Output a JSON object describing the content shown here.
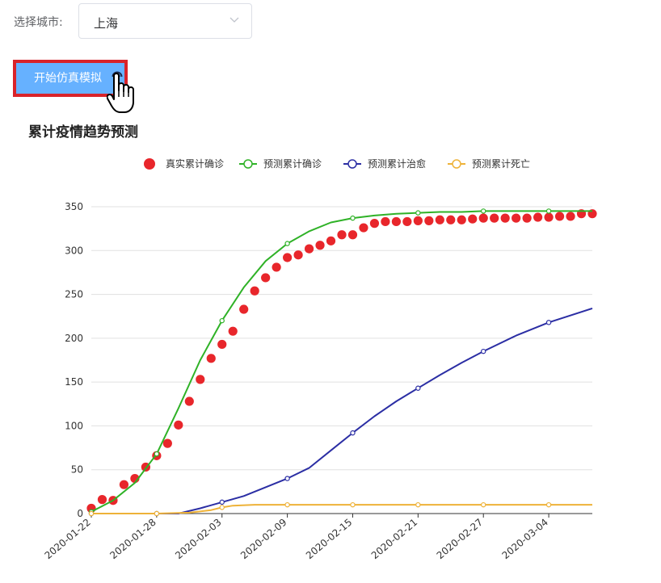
{
  "form": {
    "label": "选择城市:",
    "city_select": {
      "value": "上海"
    }
  },
  "start_button": {
    "label": "开始仿真模拟"
  },
  "colors": {
    "real": "#e8262b",
    "pred_confirmed": "#2fb227",
    "pred_recovered": "#2b2ea4",
    "pred_death": "#eeb238",
    "button": "#66b1ff",
    "button_border": "#d9232a"
  },
  "chart_data": {
    "type": "line",
    "title": "累计疫情趋势预测",
    "xlabel": "",
    "ylabel": "",
    "ylim": [
      0,
      350
    ],
    "yticks": [
      0,
      50,
      100,
      150,
      200,
      250,
      300,
      350
    ],
    "legend_position": "top-center",
    "grid": "horizontal",
    "x_start": "2020-01-22",
    "x_end": "2020-03-08",
    "xticks": [
      "2020-01-22",
      "2020-01-28",
      "2020-02-03",
      "2020-02-09",
      "2020-02-15",
      "2020-02-21",
      "2020-02-27",
      "2020-03-04"
    ],
    "series": [
      {
        "name": "真实累计确诊",
        "kind": "scatter",
        "x": [
          "2020-01-22",
          "2020-01-23",
          "2020-01-24",
          "2020-01-25",
          "2020-01-26",
          "2020-01-27",
          "2020-01-28",
          "2020-01-29",
          "2020-01-30",
          "2020-01-31",
          "2020-02-01",
          "2020-02-02",
          "2020-02-03",
          "2020-02-04",
          "2020-02-05",
          "2020-02-06",
          "2020-02-07",
          "2020-02-08",
          "2020-02-09",
          "2020-02-10",
          "2020-02-11",
          "2020-02-12",
          "2020-02-13",
          "2020-02-14",
          "2020-02-15",
          "2020-02-16",
          "2020-02-17",
          "2020-02-18",
          "2020-02-19",
          "2020-02-20",
          "2020-02-21",
          "2020-02-22",
          "2020-02-23",
          "2020-02-24",
          "2020-02-25",
          "2020-02-26",
          "2020-02-27",
          "2020-02-28",
          "2020-02-29",
          "2020-03-01",
          "2020-03-02",
          "2020-03-03",
          "2020-03-04",
          "2020-03-05",
          "2020-03-06",
          "2020-03-07",
          "2020-03-08"
        ],
        "values": [
          6,
          16,
          15,
          33,
          40,
          53,
          66,
          80,
          101,
          128,
          153,
          177,
          193,
          208,
          233,
          254,
          269,
          281,
          292,
          295,
          302,
          306,
          311,
          318,
          318,
          326,
          331,
          333,
          333,
          333,
          334,
          334,
          335,
          335,
          335,
          336,
          337,
          337,
          337,
          337,
          337,
          338,
          338,
          339,
          339,
          342,
          342
        ]
      },
      {
        "name": "预测累计确诊",
        "kind": "line",
        "x": [
          "2020-01-22",
          "2020-01-24",
          "2020-01-26",
          "2020-01-28",
          "2020-01-30",
          "2020-02-01",
          "2020-02-03",
          "2020-02-05",
          "2020-02-07",
          "2020-02-09",
          "2020-02-11",
          "2020-02-13",
          "2020-02-15",
          "2020-02-17",
          "2020-02-19",
          "2020-02-21",
          "2020-02-23",
          "2020-02-25",
          "2020-02-27",
          "2020-03-01",
          "2020-03-04",
          "2020-03-08"
        ],
        "values": [
          2,
          15,
          35,
          68,
          120,
          175,
          220,
          258,
          288,
          308,
          322,
          332,
          337,
          340,
          342,
          343,
          344,
          344,
          345,
          345,
          345,
          345
        ],
        "markers": [
          "2020-01-22",
          "2020-01-28",
          "2020-02-03",
          "2020-02-09",
          "2020-02-15",
          "2020-02-21",
          "2020-02-27",
          "2020-03-04"
        ]
      },
      {
        "name": "预测累计治愈",
        "kind": "line",
        "x": [
          "2020-01-22",
          "2020-01-26",
          "2020-01-28",
          "2020-01-30",
          "2020-02-01",
          "2020-02-03",
          "2020-02-05",
          "2020-02-07",
          "2020-02-09",
          "2020-02-11",
          "2020-02-13",
          "2020-02-15",
          "2020-02-17",
          "2020-02-19",
          "2020-02-21",
          "2020-02-23",
          "2020-02-25",
          "2020-02-27",
          "2020-03-01",
          "2020-03-04",
          "2020-03-08"
        ],
        "values": [
          0,
          0,
          0,
          0,
          6,
          13,
          20,
          30,
          40,
          52,
          72,
          92,
          111,
          128,
          143,
          158,
          172,
          185,
          203,
          218,
          234
        ],
        "markers": [
          "2020-01-22",
          "2020-01-28",
          "2020-02-03",
          "2020-02-09",
          "2020-02-15",
          "2020-02-21",
          "2020-02-27",
          "2020-03-04"
        ]
      },
      {
        "name": "预测累计死亡",
        "kind": "line",
        "x": [
          "2020-01-22",
          "2020-01-28",
          "2020-01-31",
          "2020-02-02",
          "2020-02-03",
          "2020-02-04",
          "2020-02-06",
          "2020-02-09",
          "2020-02-15",
          "2020-02-21",
          "2020-02-27",
          "2020-03-04",
          "2020-03-08"
        ],
        "values": [
          0,
          0,
          1,
          4,
          7,
          9,
          10,
          10,
          10,
          10,
          10,
          10,
          10
        ],
        "markers": [
          "2020-01-22",
          "2020-01-28",
          "2020-02-03",
          "2020-02-09",
          "2020-02-15",
          "2020-02-21",
          "2020-02-27",
          "2020-03-04"
        ]
      }
    ]
  }
}
